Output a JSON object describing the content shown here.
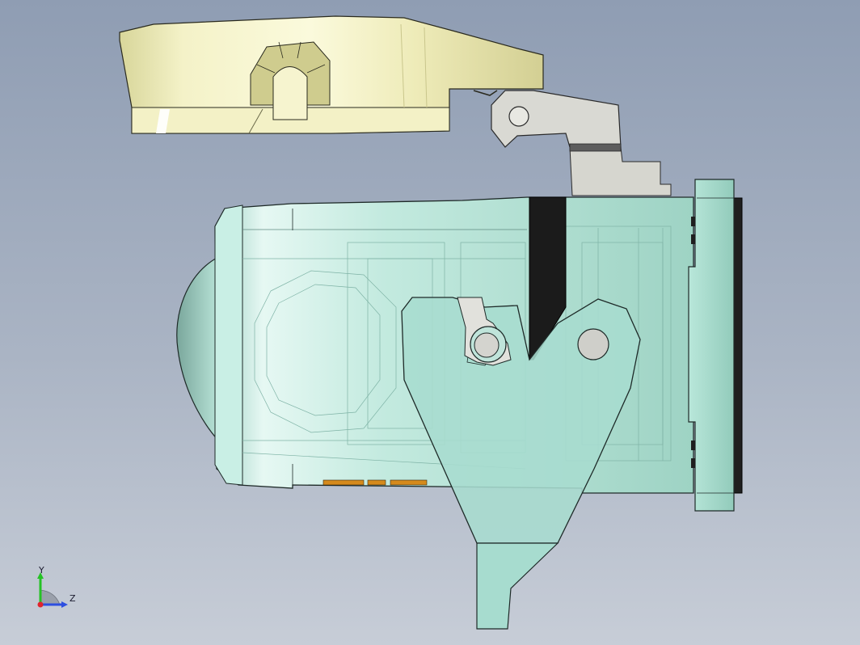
{
  "viewport": {
    "background_top": "#8f9db3",
    "background_bottom": "#c7cdd7"
  },
  "model": {
    "colors": {
      "cover": "#f1efc2",
      "cover_shade": "#d9d79a",
      "housing": "#b7e6da",
      "housing_shade": "#8fcfbf",
      "lever": "#a6ddd0",
      "latch": "#dcdcd6",
      "seal": "#1b1b1b",
      "edge": "#1e2a28",
      "contact": "#d58a1c"
    }
  },
  "view_triad": {
    "y_label": "Y",
    "z_label": "Z",
    "y_color": "#25c225",
    "z_color": "#2d4fe0",
    "x_color": "#e0252d"
  }
}
